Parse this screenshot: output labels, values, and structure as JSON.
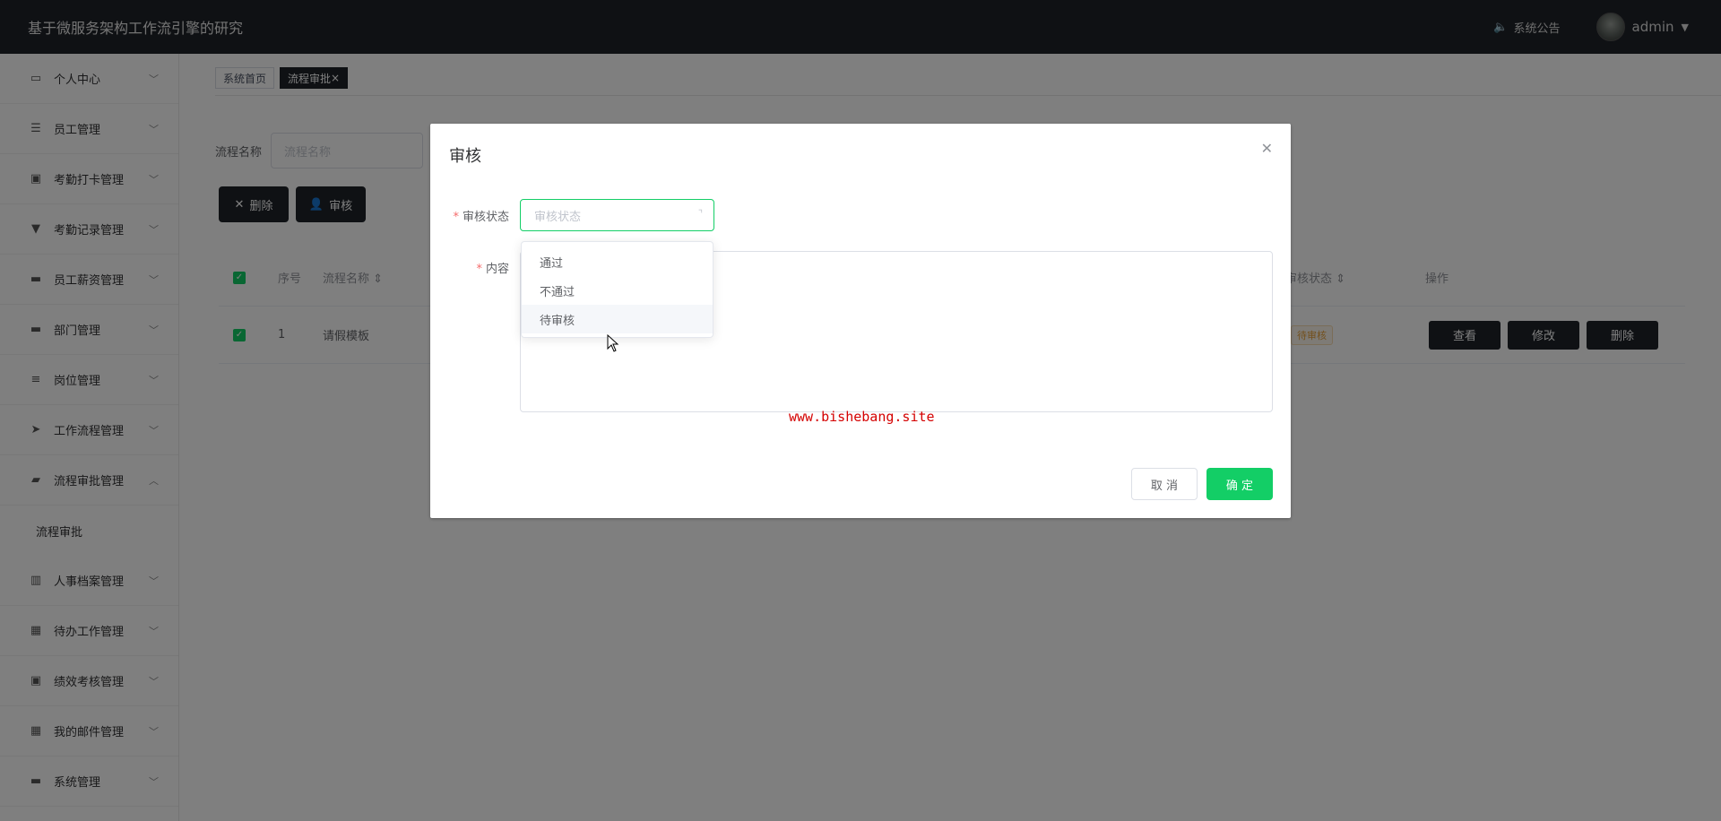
{
  "header": {
    "title": "基于微服务架构工作流引擎的研究",
    "notice_label": "系统公告",
    "user_name": "admin"
  },
  "sidebar": {
    "items": [
      {
        "label": "个人中心",
        "icon": "profile-icon"
      },
      {
        "label": "员工管理",
        "icon": "sliders-icon"
      },
      {
        "label": "考勤打卡管理",
        "icon": "clipboard-icon"
      },
      {
        "label": "考勤记录管理",
        "icon": "pin-icon"
      },
      {
        "label": "员工薪资管理",
        "icon": "chat-icon"
      },
      {
        "label": "部门管理",
        "icon": "briefcase-icon"
      },
      {
        "label": "岗位管理",
        "icon": "list-icon"
      },
      {
        "label": "工作流程管理",
        "icon": "send-icon"
      },
      {
        "label": "流程审批管理",
        "icon": "wallet-icon"
      },
      {
        "label": "人事档案管理",
        "icon": "book-icon"
      },
      {
        "label": "待办工作管理",
        "icon": "grid-icon"
      },
      {
        "label": "绩效考核管理",
        "icon": "clipboard-icon"
      },
      {
        "label": "我的邮件管理",
        "icon": "grid-icon"
      },
      {
        "label": "系统管理",
        "icon": "monitor-icon"
      }
    ],
    "sub_item": "流程审批"
  },
  "tabs": [
    {
      "label": "系统首页",
      "active": false
    },
    {
      "label": "流程审批",
      "active": true
    }
  ],
  "search": {
    "label": "流程名称",
    "placeholder": "流程名称"
  },
  "toolbar": {
    "delete_label": "删除",
    "audit_label": "审核"
  },
  "table": {
    "headers": {
      "index": "序号",
      "name": "流程名称",
      "status": "审核状态",
      "action": "操作"
    },
    "rows": [
      {
        "index": "1",
        "name": "请假模板",
        "status": "待审核"
      }
    ],
    "row_actions": {
      "view": "查看",
      "edit": "修改",
      "delete": "删除"
    }
  },
  "dialog": {
    "title": "审核",
    "status_label": "审核状态",
    "status_placeholder": "审核状态",
    "content_label": "内容",
    "cancel_label": "取 消",
    "ok_label": "确 定",
    "watermark": "www.bishebang.site",
    "options": [
      "通过",
      "不通过",
      "待审核"
    ],
    "hovered_option": "待审核"
  },
  "colors": {
    "header_bg": "#1f2329",
    "accent": "#13ce66",
    "required": "#f56c6c",
    "watermark": "#d40000"
  }
}
